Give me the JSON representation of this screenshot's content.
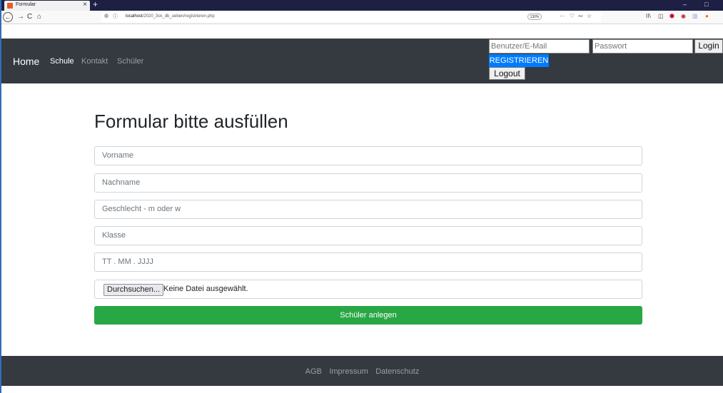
{
  "browser": {
    "tab_title": "Formular",
    "tab_close": "×",
    "new_tab": "+",
    "window_controls": [
      "–",
      "□"
    ],
    "nav": {
      "back": "←",
      "forward": "→",
      "reload": "C",
      "home": "⌂"
    },
    "url_prefix": "localhost",
    "url_path": "/2020_3ck_db_ueben/registrieren.php",
    "zoom": "130%",
    "url_actions": [
      "···",
      "♡",
      "∾",
      "☆"
    ],
    "toolbar_icons": [
      {
        "name": "library-icon",
        "glyph": "II\\",
        "color": "#444444"
      },
      {
        "name": "sidebar-icon",
        "glyph": "◫",
        "color": "#444444"
      },
      {
        "name": "ublock-icon",
        "glyph": "⬢",
        "color": "#c4182a"
      },
      {
        "name": "extension-icon",
        "glyph": "◉",
        "color": "#c4182a"
      },
      {
        "name": "bars-icon",
        "glyph": "▥",
        "color": "#9b9bd8"
      },
      {
        "name": "firefox-icon",
        "glyph": "●",
        "color": "#ee6b16"
      }
    ]
  },
  "navbar": {
    "brand": "Home",
    "links": [
      "Schule",
      "Kontakt",
      "Schüler"
    ],
    "login": {
      "user_placeholder": "Benutzer/E-Mail",
      "password_placeholder": "Passwort",
      "login_label": "Login",
      "register_label": "REGISTRIEREN",
      "logout_label": "Logout"
    }
  },
  "main": {
    "title": "Formular bitte ausfüllen",
    "fields": [
      "Vorname",
      "Nachname",
      "Geschlecht  - m oder w",
      "Klasse",
      "TT . MM . JJJJ"
    ],
    "file_button": "Durchsuchen...",
    "file_status": "Keine Datei ausgewählt.",
    "submit": "Schüler anlegen"
  },
  "footer": {
    "links": [
      "AGB",
      "Impressum",
      "Datenschutz"
    ]
  },
  "colors": {
    "navbar_bg": "#343a40",
    "primary": "#007bff",
    "success": "#28a745",
    "browser_tabbar": "#1d2043"
  }
}
